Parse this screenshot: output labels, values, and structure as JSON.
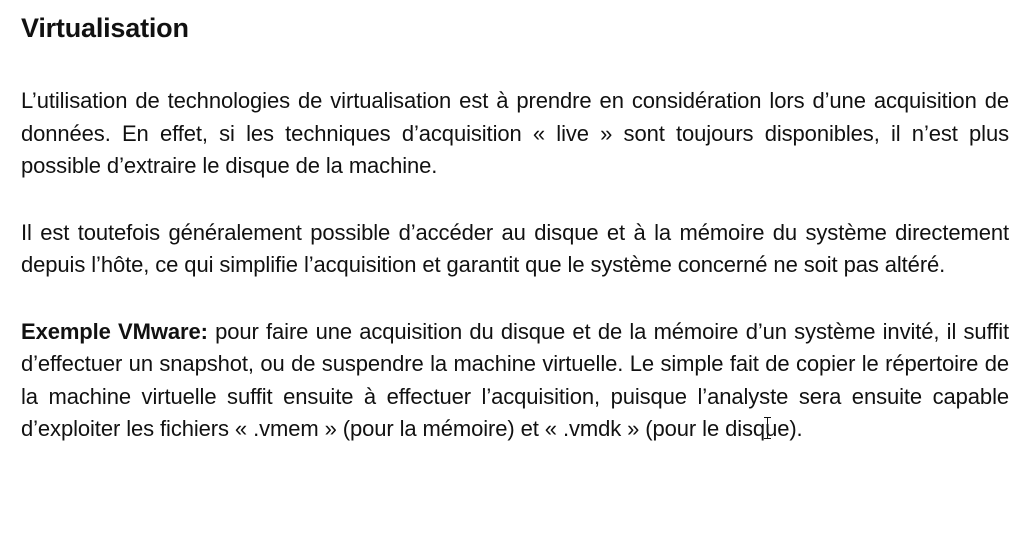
{
  "document": {
    "title": "Virtualisation",
    "paragraph1": "L’utilisation de technologies de virtualisation est à prendre en considération lors d’une acquisition de données. En effet, si les techniques d’acquisition « live » sont toujours disponibles, il n’est plus possible d’extraire le disque de la machine.",
    "paragraph2": "Il est toutefois généralement possible d’accéder au disque et à la mémoire du système directement depuis l’hôte, ce qui simplifie l’acquisition et garantit que le système concerné ne soit pas altéré.",
    "paragraph3_label": "Exemple VMware:",
    "paragraph3_text_before_cursor": " pour faire une acquisition du disque et de la mémoire d’un système invité, il suffit d’effectuer un snapshot, ou de suspendre la machine virtuelle. Le simple fait de copier le répertoire de la machine virtuelle suffit ensuite à effectuer l’acquisition, puisque l’analyste sera ensuite capable d’exploiter les fichiers « .vmem » (pour la mémoire) et « .vmdk » (pour le disq",
    "paragraph3_text_after_cursor": "ue)."
  }
}
